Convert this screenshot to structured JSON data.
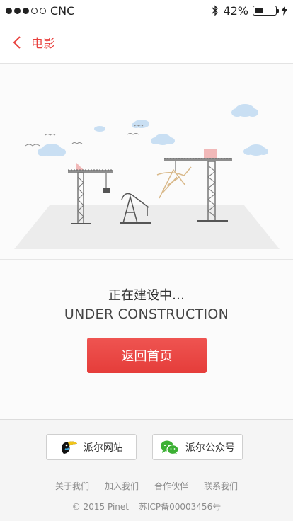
{
  "status_bar": {
    "carrier": "CNC",
    "battery_text": "42%",
    "battery_level": 0.42,
    "signal_bars_filled": 3,
    "signal_bars_total": 5
  },
  "nav": {
    "back_label": "电影"
  },
  "main": {
    "title_cn": "正在建设中…",
    "title_en": "UNDER CONSTRUCTION",
    "home_button": "返回首页"
  },
  "footer": {
    "share_buttons": [
      {
        "label": "派尔网站",
        "icon": "toucan-logo-icon"
      },
      {
        "label": "派尔公众号",
        "icon": "wechat-icon"
      }
    ],
    "links": [
      "关于我们",
      "加入我们",
      "合作伙伴",
      "联系我们"
    ],
    "copyright": "© 2015 Pinet",
    "icp": "苏ICP备00003456号"
  },
  "colors": {
    "accent": "#e8423f",
    "button": "#e8423f",
    "wechat": "#3cb034"
  }
}
